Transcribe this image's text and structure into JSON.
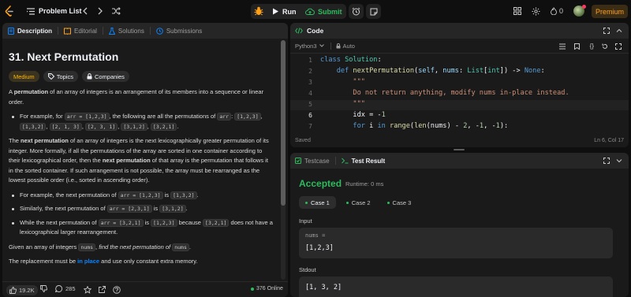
{
  "topbar": {
    "problem_list": "Problem List",
    "run": "Run",
    "submit": "Submit",
    "streak": "0",
    "premium": "Premium"
  },
  "left": {
    "tabs": [
      "Description",
      "Editorial",
      "Solutions",
      "Submissions"
    ],
    "title": "31. Next Permutation",
    "difficulty": "Medium",
    "chips": [
      "Topics",
      "Companies"
    ],
    "desc": {
      "p1_bold": "permutation",
      "p1_a": "A ",
      "p1_b": " of an array of integers is an arrangement of its members into a sequence or linear order.",
      "b1_a": "For example, for ",
      "b1_code": "arr = [1,2,3]",
      "b1_b": ", the following are all the permutations of ",
      "b1_code2": "arr",
      "b1_c": ": ",
      "b1_list": [
        "[1,2,3]",
        "[1,3,2]",
        "[2, 1, 3]",
        "[2, 3, 1]",
        "[3,1,2]",
        "[3,2,1]"
      ],
      "b1_end": ".",
      "p2_a": "The ",
      "p2_bold1": "next permutation",
      "p2_b": " of an array of integers is the next lexicographically greater permutation of its integer. More formally, if all the permutations of the array are sorted in one container according to their lexicographical order, then the ",
      "p2_bold2": "next permutation",
      "p2_c": " of that array is the permutation that follows it in the sorted container. If such arrangement is not possible, the array must be rearranged as the lowest possible order (i.e., sorted in ascending order).",
      "b2_a": "For example, the next permutation of ",
      "b2_code": "arr = [1,2,3]",
      "b2_b": " is ",
      "b2_code2": "[1,3,2]",
      "b2_c": ".",
      "b3_a": "Similarly, the next permutation of ",
      "b3_code": "arr = [2,3,1]",
      "b3_b": " is ",
      "b3_code2": "[3,1,2]",
      "b3_c": ".",
      "b4_a": "While the next permutation of ",
      "b4_code": "arr = [3,2,1]",
      "b4_b": " is ",
      "b4_code2": "[1,2,3]",
      "b4_c": " because ",
      "b4_code3": "[3,2,1]",
      "b4_d": " does not have a lexicographical larger rearrangement.",
      "p3_a": "Given an array of integers ",
      "p3_code": "nums",
      "p3_b": ", ",
      "p3_i": "find the next permutation of",
      "p3_code2": "nums",
      "p3_c": ".",
      "p4_a": "The replacement must be ",
      "p4_link": "in place",
      "p4_b": " and use only constant extra memory."
    },
    "footer": {
      "likes": "19.2K",
      "comments": "285",
      "online": "376 Online"
    }
  },
  "code": {
    "title": "Code",
    "language": "Python3",
    "mode": "Auto",
    "line_numbers": [
      "1",
      "2",
      "3",
      "4",
      "5",
      "6",
      "7"
    ],
    "status": "Saved",
    "cursor": "Ln 6, Col 17"
  },
  "result": {
    "tabs": [
      "Testcase",
      "Test Result"
    ],
    "verdict": "Accepted",
    "runtime": "Runtime: 0 ms",
    "cases": [
      "Case 1",
      "Case 2",
      "Case 3"
    ],
    "input_label": "Input",
    "input_var": "nums =",
    "input_val": "[1,2,3]",
    "stdout_label": "Stdout",
    "stdout_val": "[1, 3, 2]"
  },
  "colors": {
    "accent": "#ffa116",
    "green": "#2cbb5d",
    "blue": "#0a84ff",
    "medium": "#ffb800"
  }
}
